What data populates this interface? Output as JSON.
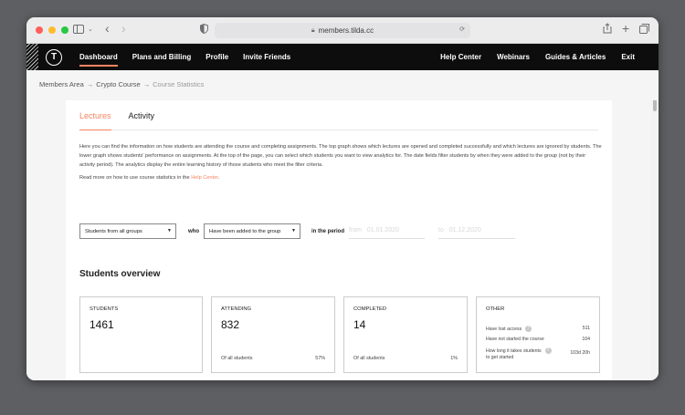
{
  "browser": {
    "url": "members.tilda.cc"
  },
  "nav": {
    "logo_letter": "T",
    "left": [
      "Dashboard",
      "Plans and Billing",
      "Profile",
      "Invite Friends"
    ],
    "right": [
      "Help Center",
      "Webinars",
      "Guides & Articles",
      "Exit"
    ]
  },
  "breadcrumb": {
    "items": [
      "Members Area",
      "Crypto Course",
      "Course Statistics"
    ],
    "separator": "→"
  },
  "tabs": [
    "Lectures",
    "Activity"
  ],
  "intro": "Here you can find the information on how students are attending the course and completing assignments. The top graph shows which lectures are opened and completed successfully and which lectures are ignored by students. The lower graph shows students' performance on assignments. At the top of the page, you can select which students you want to view analytics for. The date fields filter students by when they were added to the group (not by their activity period). The analytics display the entire learning history of those students who meet the filter criteria.",
  "more_text": "Read more on how to use course statistics in the ",
  "more_link": "Help Center",
  "more_end": ".",
  "filters": {
    "group_select": "Students from all groups",
    "who_label": "who",
    "status_select": "Have been added to the group",
    "period_label": "in the period",
    "from_placeholder": "from",
    "from_date": "01.01.2020",
    "to_placeholder": "to",
    "to_date": "01.12.2020"
  },
  "overview": {
    "title": "Students overview",
    "students": {
      "label": "STUDENTS",
      "value": "1461"
    },
    "attending": {
      "label": "ATTENDING",
      "value": "832",
      "foot_label": "Of all students",
      "foot_value": "57%"
    },
    "completed": {
      "label": "COMPLETED",
      "value": "14",
      "foot_label": "Of all students",
      "foot_value": "1%"
    },
    "other": {
      "label": "OTHER",
      "rows": [
        {
          "label": "Have lost access",
          "value": "511"
        },
        {
          "label": "Have not started the course",
          "value": "104"
        },
        {
          "label_line1": "How long it takes students",
          "label_line2": "to get started",
          "value": "103d 20h"
        }
      ]
    }
  }
}
